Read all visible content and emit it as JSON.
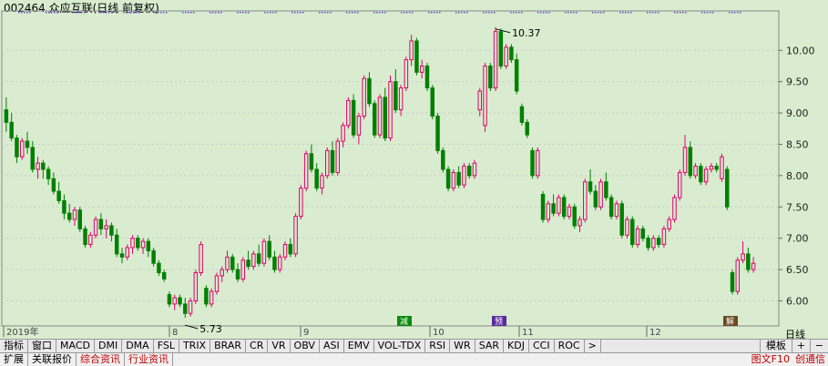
{
  "title": "002464 众应互联(日线 前复权)",
  "period_label": "日线",
  "chart_data": {
    "type": "candlestick",
    "ylim": [
      5.6,
      10.6
    ],
    "yticks": [
      "6.00",
      "6.50",
      "7.00",
      "7.50",
      "8.00",
      "8.50",
      "9.00",
      "9.50",
      "10.00"
    ],
    "xlabels": [
      "2019年",
      "8",
      "9",
      "10",
      "11",
      "12"
    ],
    "high_annotation": "10.37",
    "low_annotation": "5.73",
    "event_markers": [
      "减",
      "预",
      "解"
    ],
    "colors": {
      "up": "#e0006a",
      "down": "#008000",
      "grid": "#c8c8c8",
      "background": "#d9ecd0"
    },
    "candles": [
      [
        9.05,
        9.25,
        8.7,
        8.85
      ],
      [
        8.85,
        9.0,
        8.55,
        8.6
      ],
      [
        8.6,
        8.65,
        8.2,
        8.3
      ],
      [
        8.3,
        8.6,
        8.25,
        8.55
      ],
      [
        8.55,
        8.7,
        8.35,
        8.45
      ],
      [
        8.45,
        8.55,
        8.05,
        8.1
      ],
      [
        8.1,
        8.3,
        7.95,
        8.2
      ],
      [
        8.2,
        8.25,
        7.95,
        8.1
      ],
      [
        8.1,
        8.15,
        7.85,
        7.95
      ],
      [
        7.95,
        8.05,
        7.7,
        7.75
      ],
      [
        7.75,
        7.9,
        7.55,
        7.6
      ],
      [
        7.6,
        7.7,
        7.3,
        7.4
      ],
      [
        7.4,
        7.55,
        7.25,
        7.3
      ],
      [
        7.3,
        7.5,
        7.2,
        7.45
      ],
      [
        7.45,
        7.5,
        7.1,
        7.15
      ],
      [
        7.15,
        7.2,
        6.85,
        6.9
      ],
      [
        6.9,
        7.1,
        6.85,
        7.05
      ],
      [
        7.05,
        7.35,
        7.0,
        7.3
      ],
      [
        7.3,
        7.4,
        7.05,
        7.15
      ],
      [
        7.15,
        7.3,
        7.0,
        7.2
      ],
      [
        7.2,
        7.25,
        6.95,
        7.05
      ],
      [
        7.05,
        7.15,
        6.7,
        6.75
      ],
      [
        6.75,
        6.85,
        6.6,
        6.7
      ],
      [
        6.7,
        6.9,
        6.65,
        6.85
      ],
      [
        6.85,
        7.05,
        6.75,
        7.0
      ],
      [
        7.0,
        7.05,
        6.8,
        6.85
      ],
      [
        6.85,
        7.0,
        6.75,
        6.95
      ],
      [
        6.95,
        7.0,
        6.7,
        6.8
      ],
      [
        6.8,
        6.85,
        6.55,
        6.6
      ],
      [
        6.6,
        6.65,
        6.4,
        6.45
      ],
      [
        6.45,
        6.5,
        6.3,
        6.35
      ],
      [
        6.1,
        6.15,
        5.9,
        5.95
      ],
      [
        5.95,
        6.1,
        5.85,
        6.05
      ],
      [
        6.05,
        6.1,
        5.9,
        5.95
      ],
      [
        5.95,
        6.05,
        5.73,
        5.8
      ],
      [
        5.8,
        6.05,
        5.75,
        6.0
      ],
      [
        6.0,
        6.5,
        5.95,
        6.45
      ],
      [
        6.45,
        6.95,
        6.4,
        6.9
      ],
      [
        6.2,
        6.25,
        5.9,
        5.95
      ],
      [
        5.95,
        6.2,
        5.9,
        6.15
      ],
      [
        6.15,
        6.45,
        6.1,
        6.4
      ],
      [
        6.4,
        6.55,
        6.3,
        6.5
      ],
      [
        6.5,
        6.8,
        6.45,
        6.7
      ],
      [
        6.7,
        6.75,
        6.45,
        6.5
      ],
      [
        6.5,
        6.6,
        6.3,
        6.35
      ],
      [
        6.35,
        6.7,
        6.3,
        6.65
      ],
      [
        6.65,
        6.8,
        6.5,
        6.55
      ],
      [
        6.55,
        6.8,
        6.5,
        6.75
      ],
      [
        6.75,
        6.9,
        6.55,
        6.6
      ],
      [
        6.6,
        7.0,
        6.55,
        6.95
      ],
      [
        6.95,
        7.05,
        6.65,
        6.7
      ],
      [
        6.7,
        6.8,
        6.45,
        6.5
      ],
      [
        6.5,
        6.75,
        6.45,
        6.7
      ],
      [
        6.7,
        6.95,
        6.65,
        6.9
      ],
      [
        6.9,
        7.0,
        6.7,
        6.75
      ],
      [
        6.75,
        7.4,
        6.7,
        7.35
      ],
      [
        7.35,
        7.85,
        7.3,
        7.8
      ],
      [
        7.8,
        8.4,
        7.75,
        8.35
      ],
      [
        8.35,
        8.5,
        8.05,
        8.1
      ],
      [
        8.1,
        8.2,
        7.75,
        7.8
      ],
      [
        7.8,
        8.05,
        7.7,
        8.0
      ],
      [
        8.0,
        8.45,
        7.95,
        8.4
      ],
      [
        8.4,
        8.55,
        8.0,
        8.05
      ],
      [
        8.05,
        8.6,
        8.0,
        8.55
      ],
      [
        8.55,
        8.85,
        8.45,
        8.8
      ],
      [
        8.8,
        9.25,
        8.75,
        9.2
      ],
      [
        9.2,
        9.3,
        8.6,
        8.65
      ],
      [
        8.65,
        9.0,
        8.5,
        8.95
      ],
      [
        8.95,
        9.6,
        8.9,
        9.55
      ],
      [
        9.55,
        9.65,
        9.1,
        9.15
      ],
      [
        9.15,
        9.2,
        8.6,
        8.65
      ],
      [
        8.65,
        9.3,
        8.6,
        9.25
      ],
      [
        9.25,
        9.4,
        8.55,
        8.6
      ],
      [
        8.6,
        9.6,
        8.55,
        9.5
      ],
      [
        9.5,
        9.7,
        9.0,
        9.05
      ],
      [
        9.05,
        9.45,
        8.95,
        9.4
      ],
      [
        9.4,
        9.9,
        9.35,
        9.85
      ],
      [
        9.85,
        10.25,
        9.75,
        10.15
      ],
      [
        10.15,
        10.2,
        9.6,
        9.65
      ],
      [
        9.65,
        9.85,
        9.55,
        9.75
      ],
      [
        9.75,
        9.8,
        9.35,
        9.4
      ],
      [
        9.4,
        9.45,
        8.9,
        8.95
      ],
      [
        8.95,
        9.0,
        8.35,
        8.4
      ],
      [
        8.4,
        8.45,
        8.05,
        8.1
      ],
      [
        8.1,
        8.15,
        7.75,
        7.8
      ],
      [
        7.8,
        8.1,
        7.75,
        8.05
      ],
      [
        8.05,
        8.15,
        7.8,
        7.85
      ],
      [
        7.85,
        8.2,
        7.8,
        8.15
      ],
      [
        8.15,
        8.2,
        7.95,
        8.0
      ],
      [
        8.0,
        8.25,
        7.95,
        8.2
      ],
      [
        9.05,
        9.4,
        8.95,
        9.35
      ],
      [
        8.8,
        9.8,
        8.7,
        9.75
      ],
      [
        9.75,
        9.8,
        9.35,
        9.4
      ],
      [
        9.4,
        10.37,
        9.35,
        10.3
      ],
      [
        10.3,
        10.35,
        9.7,
        9.75
      ],
      [
        9.75,
        10.1,
        9.7,
        10.05
      ],
      [
        10.05,
        10.1,
        9.8,
        9.85
      ],
      [
        9.85,
        9.95,
        9.3,
        9.35
      ],
      [
        9.1,
        9.15,
        8.8,
        8.85
      ],
      [
        8.85,
        8.9,
        8.6,
        8.65
      ],
      [
        8.4,
        8.45,
        7.95,
        8.0
      ],
      [
        8.0,
        8.45,
        7.95,
        8.4
      ],
      [
        7.7,
        7.75,
        7.25,
        7.3
      ],
      [
        7.3,
        7.6,
        7.25,
        7.55
      ],
      [
        7.55,
        7.7,
        7.35,
        7.4
      ],
      [
        7.4,
        7.7,
        7.35,
        7.65
      ],
      [
        7.65,
        7.7,
        7.3,
        7.35
      ],
      [
        7.35,
        7.55,
        7.3,
        7.5
      ],
      [
        7.5,
        7.55,
        7.15,
        7.2
      ],
      [
        7.2,
        7.35,
        7.1,
        7.3
      ],
      [
        7.3,
        7.95,
        7.25,
        7.9
      ],
      [
        7.9,
        8.1,
        7.7,
        7.75
      ],
      [
        7.75,
        7.85,
        7.45,
        7.5
      ],
      [
        7.5,
        7.95,
        7.45,
        7.9
      ],
      [
        7.9,
        8.05,
        7.6,
        7.65
      ],
      [
        7.65,
        7.7,
        7.3,
        7.35
      ],
      [
        7.35,
        7.6,
        7.3,
        7.55
      ],
      [
        7.55,
        7.6,
        7.0,
        7.05
      ],
      [
        7.05,
        7.35,
        7.0,
        7.3
      ],
      [
        7.3,
        7.35,
        6.85,
        6.9
      ],
      [
        6.9,
        7.2,
        6.85,
        7.15
      ],
      [
        7.15,
        7.2,
        6.95,
        7.0
      ],
      [
        7.0,
        7.05,
        6.8,
        6.85
      ],
      [
        6.85,
        7.05,
        6.8,
        7.0
      ],
      [
        7.0,
        7.05,
        6.85,
        6.9
      ],
      [
        6.9,
        7.2,
        6.85,
        7.15
      ],
      [
        7.15,
        7.35,
        7.1,
        7.3
      ],
      [
        7.3,
        7.7,
        7.25,
        7.65
      ],
      [
        7.65,
        8.1,
        7.6,
        8.05
      ],
      [
        8.05,
        8.65,
        8.0,
        8.45
      ],
      [
        8.45,
        8.55,
        7.95,
        8.0
      ],
      [
        8.0,
        8.2,
        7.95,
        8.15
      ],
      [
        8.15,
        8.2,
        7.85,
        7.9
      ],
      [
        7.9,
        8.15,
        7.85,
        8.1
      ],
      [
        8.1,
        8.2,
        8.05,
        8.15
      ],
      [
        8.15,
        8.2,
        8.05,
        8.1
      ],
      [
        7.95,
        8.35,
        7.9,
        8.3
      ],
      [
        8.1,
        8.15,
        7.45,
        7.5
      ],
      [
        6.45,
        6.5,
        6.1,
        6.15
      ],
      [
        6.15,
        6.7,
        6.1,
        6.65
      ],
      [
        6.65,
        6.95,
        6.6,
        6.75
      ],
      [
        6.75,
        6.85,
        6.45,
        6.5
      ],
      [
        6.5,
        6.7,
        6.45,
        6.6
      ]
    ]
  },
  "indicator_tabs": [
    "指标",
    "窗口",
    "MACD",
    "DMI",
    "DMA",
    "FSL",
    "TRIX",
    "BRAR",
    "CR",
    "VR",
    "OBV",
    "ASI",
    "EMV",
    "VOL-TDX",
    "RSI",
    "WR",
    "SAR",
    "KDJ",
    "CCI",
    "ROC",
    ">"
  ],
  "template_label": "模板",
  "plus_label": "+",
  "minus_label": "−",
  "bottom_tabs": [
    "扩展",
    "关联报价",
    "综合资讯",
    "行业资讯"
  ],
  "bottom_tab_colors": [
    "#000",
    "#000",
    "#c00000",
    "#c00000"
  ],
  "bottom_right_tabs": [
    "图文F10",
    "创通信"
  ]
}
